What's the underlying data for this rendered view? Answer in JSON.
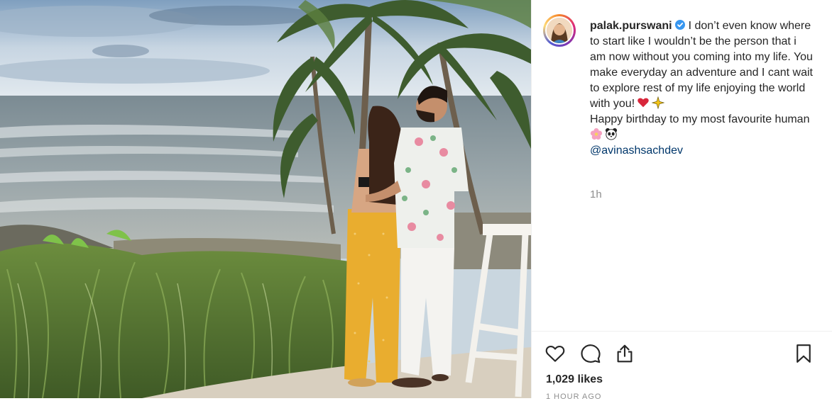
{
  "post": {
    "username": "palak.purswani",
    "verified_icon": "verified-badge-icon",
    "caption_part1": "I don’t even know where to start like I wouldn’t be the person that i am now without you coming into my life. You make everyday an adventure and I cant wait to explore rest of my life enjoying the world with you!",
    "caption_part2": "Happy birthday to my most favourite human",
    "mention": "@avinashsachdev",
    "time": "1h",
    "likes": "1,029 likes",
    "date": "1 HOUR AGO",
    "emojis": [
      "red-heart-emoji",
      "sparkle-star-emoji",
      "cherry-blossom-emoji",
      "panda-emoji"
    ]
  },
  "actions": {
    "icons": [
      "heart-icon",
      "comment-icon",
      "share-icon",
      "bookmark-icon"
    ]
  },
  "colors": {
    "text": "#262626",
    "secondary": "#8e8e8e",
    "mention": "#00376b",
    "verified": "#3897f0",
    "border": "#efefef"
  }
}
